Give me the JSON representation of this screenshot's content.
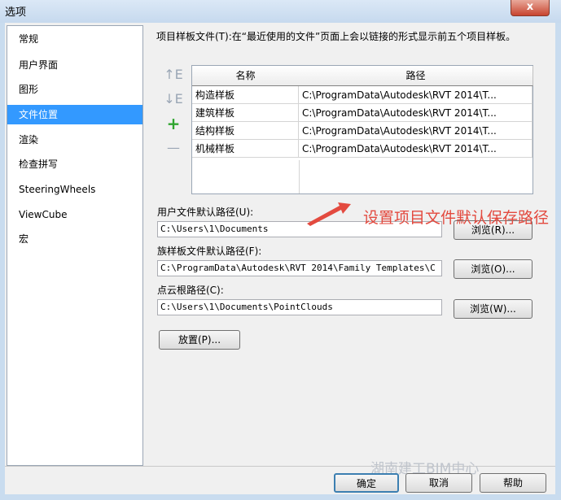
{
  "window": {
    "title": "选项",
    "close_label": "x"
  },
  "sidebar": {
    "items": [
      {
        "label": "常规"
      },
      {
        "label": "用户界面"
      },
      {
        "label": "图形"
      },
      {
        "label": "文件位置"
      },
      {
        "label": "渲染"
      },
      {
        "label": "检查拼写"
      },
      {
        "label": "SteeringWheels"
      },
      {
        "label": "ViewCube"
      },
      {
        "label": "宏"
      }
    ],
    "selected": "文件位置"
  },
  "templates": {
    "description": "项目样板文件(T):在“最近使用的文件”页面上会以链接的形式显示前五个项目样板。",
    "columns": [
      "名称",
      "路径"
    ],
    "rows": [
      {
        "name": "构造样板",
        "path": "C:\\ProgramData\\Autodesk\\RVT 2014\\T..."
      },
      {
        "name": "建筑样板",
        "path": "C:\\ProgramData\\Autodesk\\RVT 2014\\T..."
      },
      {
        "name": "结构样板",
        "path": "C:\\ProgramData\\Autodesk\\RVT 2014\\T..."
      },
      {
        "name": "机械样板",
        "path": "C:\\ProgramData\\Autodesk\\RVT 2014\\T..."
      }
    ],
    "toolbar": {
      "move_up_icon": "move-up-icon",
      "move_down_icon": "move-down-icon",
      "add_icon": "plus-icon",
      "remove_icon": "minus-icon"
    }
  },
  "user_path": {
    "label": "用户文件默认路径(U):",
    "value": "C:\\Users\\1\\Documents",
    "browse": "浏览(R)..."
  },
  "family_path": {
    "label": "族样板文件默认路径(F):",
    "value": "C:\\ProgramData\\Autodesk\\RVT 2014\\Family Templates\\C",
    "browse": "浏览(O)..."
  },
  "cloud_path": {
    "label": "点云根路径(C):",
    "value": "C:\\Users\\1\\Documents\\PointClouds",
    "browse": "浏览(W)..."
  },
  "places_button": "放置(P)...",
  "annotation": "设置项目文件默认保存路径",
  "watermark": "湖南建工BIM中心",
  "footer": {
    "ok": "确定",
    "cancel": "取消",
    "help": "帮助"
  },
  "colors": {
    "selection": "#3399ff",
    "annotation": "#e34a3f"
  }
}
